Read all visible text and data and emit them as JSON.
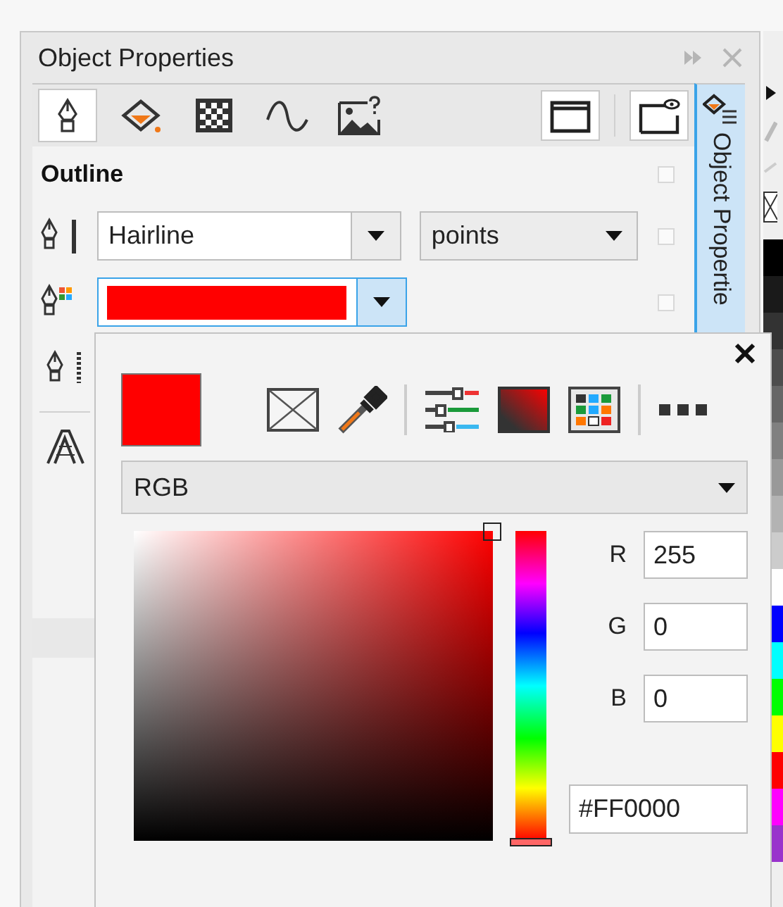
{
  "window": {
    "title": "Object Properties"
  },
  "tabs": [
    {
      "kind": "outline",
      "selected": true
    },
    {
      "kind": "fill",
      "selected": false
    },
    {
      "kind": "transparency",
      "selected": false
    },
    {
      "kind": "curve",
      "selected": false
    },
    {
      "kind": "image",
      "selected": false
    }
  ],
  "docker_tab": {
    "label": "Object Propertie"
  },
  "outline": {
    "title": "Outline",
    "width": "Hairline",
    "units": "points",
    "color": "#ff0000",
    "color_dropdown_expanded": true,
    "checkboxes": [
      {
        "checked": false
      },
      {
        "checked": false
      },
      {
        "checked": false
      }
    ]
  },
  "color_picker": {
    "model": "RGB",
    "hue": {
      "level": 0
    },
    "channels": [
      {
        "label": "R",
        "value": "255"
      },
      {
        "label": "G",
        "value": "0"
      },
      {
        "label": "B",
        "value": "0"
      }
    ],
    "hex": "#FF0000"
  },
  "palette": [
    {
      "color": "#000000"
    },
    {
      "color": "#1a1a1a"
    },
    {
      "color": "#333333"
    },
    {
      "color": "#4d4d4d"
    },
    {
      "color": "#666666"
    },
    {
      "color": "#808080"
    },
    {
      "color": "#999999"
    },
    {
      "color": "#b3b3b3"
    },
    {
      "color": "#cccccc"
    },
    {
      "color": "#ffffff"
    },
    {
      "color": "#0000ff"
    },
    {
      "color": "#00ffff"
    },
    {
      "color": "#00ff00"
    },
    {
      "color": "#ffff00"
    },
    {
      "color": "#ff0000"
    },
    {
      "color": "#ff00ff"
    },
    {
      "color": "#9933cc"
    }
  ]
}
